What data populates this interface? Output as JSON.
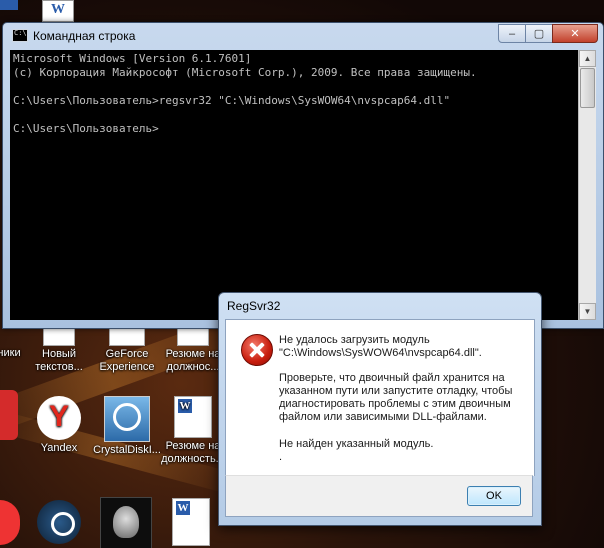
{
  "cmd_window": {
    "title": "Командная строка",
    "buttons": {
      "minimize": "–",
      "maximize": "▢",
      "close": "✕"
    },
    "console_lines": [
      "Microsoft Windows [Version 6.1.7601]",
      "(c) Корпорация Майкрософт (Microsoft Corp.), 2009. Все права защищены.",
      "",
      "C:\\Users\\Пользователь>regsvr32 \"C:\\Windows\\SysWOW64\\nvspcap64.dll\"",
      "",
      "C:\\Users\\Пользователь>"
    ]
  },
  "dialog": {
    "title": "RegSvr32",
    "message_1": "Не удалось загрузить модуль \"C:\\Windows\\SysWOW64\\nvspcap64.dll\".",
    "message_2": "Проверьте, что двоичный файл хранится на указанном пути или запустите отладку, чтобы диагностировать проблемы с этим двоичным файлом или зависимыми DLL-файлами.",
    "message_3": "Не найден указанный модуль.",
    "message_4": ".",
    "ok_label": "OK",
    "icon": "error-icon"
  },
  "desktop": {
    "icons": [
      {
        "name": "desktop-icon-partial-left-1",
        "label": "ники"
      },
      {
        "name": "desktop-icon-new-text",
        "label": "Новый текстов..."
      },
      {
        "name": "desktop-icon-geforce",
        "label": "GeForce Experience"
      },
      {
        "name": "desktop-icon-resume-1",
        "label": "Резюме на должнос..."
      },
      {
        "name": "desktop-icon-yandex",
        "label": "Yandex"
      },
      {
        "name": "desktop-icon-crystaldisk",
        "label": "CrystalDiskI..."
      },
      {
        "name": "desktop-icon-resume-2",
        "label": "Резюме на должность..."
      }
    ]
  },
  "colors": {
    "console_bg": "#000000",
    "console_text": "#c0c0c0",
    "error_red": "#c81d0e"
  }
}
